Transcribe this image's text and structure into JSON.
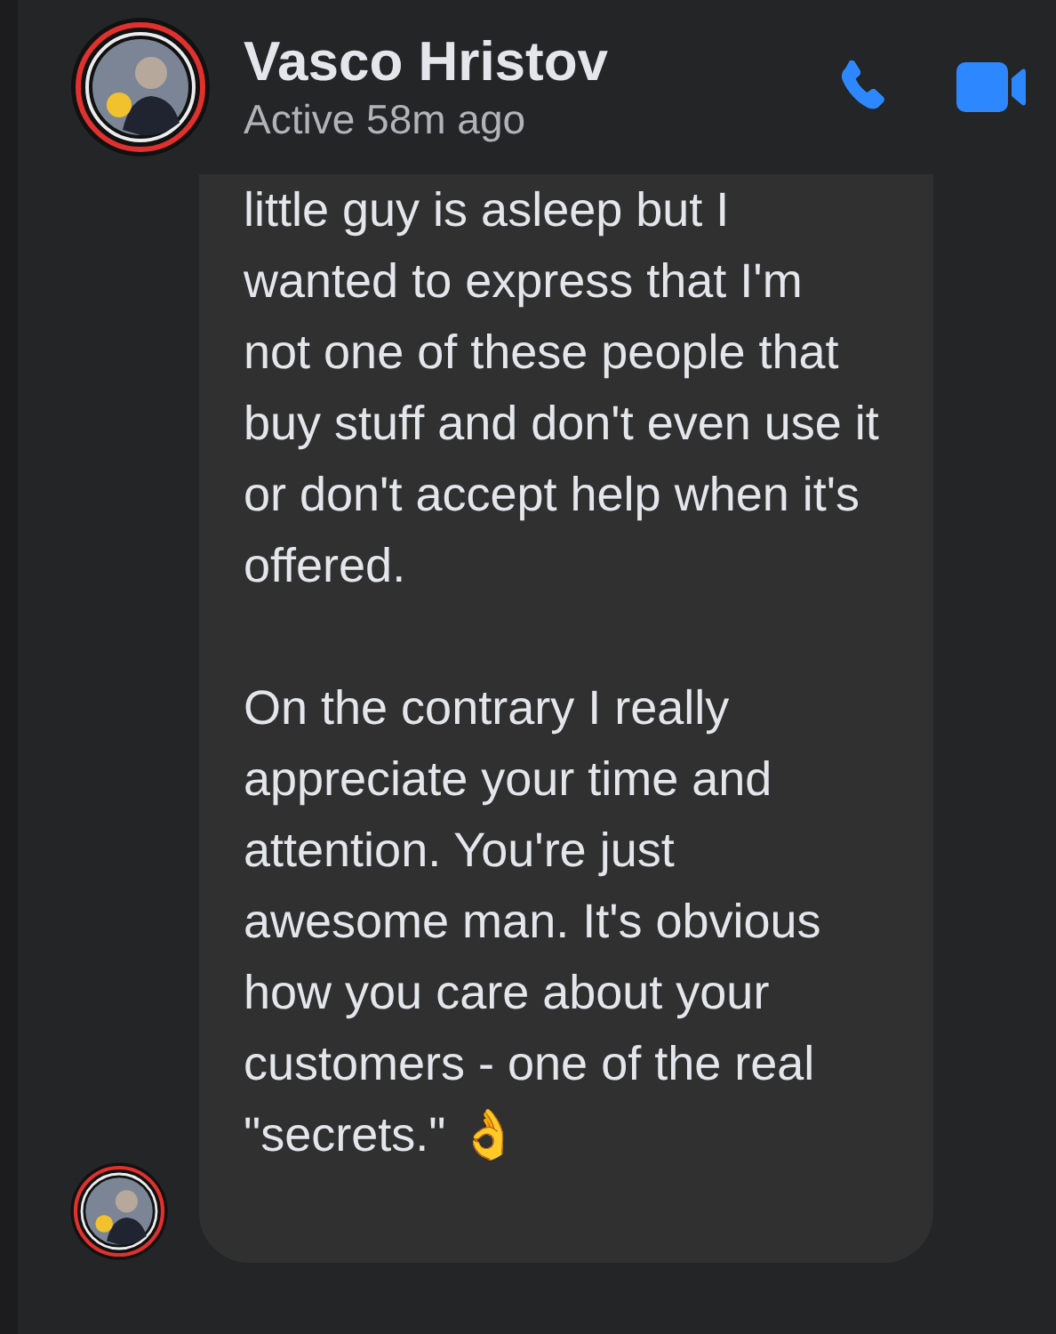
{
  "header": {
    "name": "Vasco Hristov",
    "status": "Active 58m ago"
  },
  "message": {
    "paragraphs": [
      "little guy is asleep but I wanted to express that I'm not one of these people that buy stuff and don't even use it or don't accept help when it's offered.",
      "On the contrary I really appreciate your time and attention. You're just awesome man. It's obvious how you care about your customers - one of the real \"secrets.\" 👌"
    ]
  }
}
